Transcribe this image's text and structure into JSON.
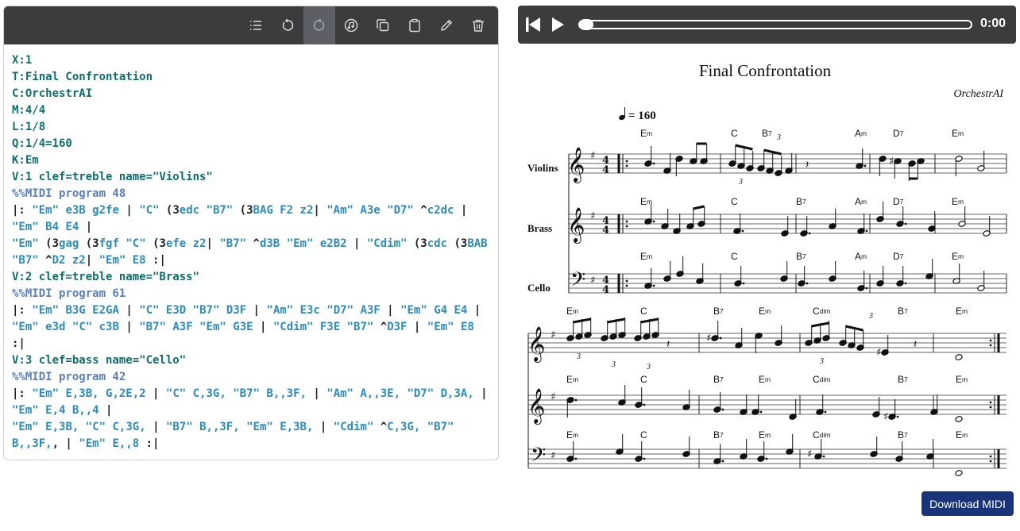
{
  "toolbar": {
    "buttons": [
      {
        "name": "format-button",
        "icon": "list-icon"
      },
      {
        "name": "undo-button",
        "icon": "undo-icon"
      },
      {
        "name": "redo-button",
        "icon": "redo-icon"
      },
      {
        "name": "publish-button",
        "icon": "music-disc-icon"
      },
      {
        "name": "copy-button",
        "icon": "copy-icon"
      },
      {
        "name": "paste-button",
        "icon": "clipboard-icon"
      },
      {
        "name": "edit-button",
        "icon": "pencil-icon"
      },
      {
        "name": "delete-button",
        "icon": "trash-icon"
      }
    ]
  },
  "abc_source": {
    "lines": [
      [
        [
          "hk",
          "X:1"
        ]
      ],
      [
        [
          "hk",
          "T:Final Confrontation"
        ]
      ],
      [
        [
          "hk",
          "C:OrchestrAI"
        ]
      ],
      [
        [
          "hk",
          "M:4/4"
        ]
      ],
      [
        [
          "hk",
          "L:1/8"
        ]
      ],
      [
        [
          "hk",
          "Q:1/4=160"
        ]
      ],
      [
        [
          "hk",
          "K:Em"
        ]
      ],
      [
        [
          "hk",
          "V:1 clef=treble name=\"Violins\""
        ]
      ],
      [
        [
          "dir",
          "%%MIDI program 48"
        ]
      ],
      [
        [
          "pl",
          "|: "
        ],
        [
          "ch",
          "\"Em\""
        ],
        [
          "pl",
          " "
        ],
        [
          "nt",
          "e3B g2fe"
        ],
        [
          "pl",
          " | "
        ],
        [
          "ch",
          "\"C\""
        ],
        [
          "pl",
          " (3"
        ],
        [
          "nt",
          "edc"
        ],
        [
          "pl",
          " "
        ],
        [
          "ch",
          "\"B7\""
        ],
        [
          "pl",
          " (3"
        ],
        [
          "nt",
          "BAG F2 z2"
        ],
        [
          "pl",
          "| "
        ],
        [
          "ch",
          "\"Am\""
        ],
        [
          "pl",
          " "
        ],
        [
          "nt",
          "A3e"
        ],
        [
          "pl",
          " "
        ],
        [
          "ch",
          "\"D7\""
        ],
        [
          "pl",
          " ^"
        ],
        [
          "nt",
          "c2dc"
        ],
        [
          "pl",
          " |"
        ]
      ],
      [
        [
          "ch",
          "\"Em\""
        ],
        [
          "pl",
          " "
        ],
        [
          "nt",
          "B4 E4"
        ],
        [
          "pl",
          " |"
        ]
      ],
      [
        [
          "ch",
          "\"Em\""
        ],
        [
          "pl",
          " (3"
        ],
        [
          "nt",
          "gag"
        ],
        [
          "pl",
          " (3"
        ],
        [
          "nt",
          "fgf"
        ],
        [
          "pl",
          " "
        ],
        [
          "ch",
          "\"C\""
        ],
        [
          "pl",
          " (3"
        ],
        [
          "nt",
          "efe z2"
        ],
        [
          "pl",
          "| "
        ],
        [
          "ch",
          "\"B7\""
        ],
        [
          "pl",
          " ^"
        ],
        [
          "nt",
          "d3B"
        ],
        [
          "pl",
          " "
        ],
        [
          "ch",
          "\"Em\""
        ],
        [
          "pl",
          " "
        ],
        [
          "nt",
          "e2B2"
        ],
        [
          "pl",
          " | "
        ],
        [
          "ch",
          "\"Cdim\""
        ],
        [
          "pl",
          " (3"
        ],
        [
          "nt",
          "cdc"
        ],
        [
          "pl",
          " (3"
        ],
        [
          "nt",
          "BAB"
        ]
      ],
      [
        [
          "ch",
          "\"B7\""
        ],
        [
          "pl",
          " ^"
        ],
        [
          "nt",
          "D2 z2"
        ],
        [
          "pl",
          "| "
        ],
        [
          "ch",
          "\"Em\""
        ],
        [
          "pl",
          " "
        ],
        [
          "nt",
          "E8"
        ],
        [
          "pl",
          " :|"
        ]
      ],
      [
        [
          "hk",
          "V:2 clef=treble name=\"Brass\""
        ]
      ],
      [
        [
          "dir",
          "%%MIDI program 61"
        ]
      ],
      [
        [
          "pl",
          "|: "
        ],
        [
          "ch",
          "\"Em\""
        ],
        [
          "pl",
          " "
        ],
        [
          "nt",
          "B3G E2GA"
        ],
        [
          "pl",
          " | "
        ],
        [
          "ch",
          "\"C\""
        ],
        [
          "pl",
          " "
        ],
        [
          "nt",
          "E3D"
        ],
        [
          "pl",
          " "
        ],
        [
          "ch",
          "\"B7\""
        ],
        [
          "pl",
          " "
        ],
        [
          "nt",
          "D3F"
        ],
        [
          "pl",
          " | "
        ],
        [
          "ch",
          "\"Am\""
        ],
        [
          "pl",
          " "
        ],
        [
          "nt",
          "E3c"
        ],
        [
          "pl",
          " "
        ],
        [
          "ch",
          "\"D7\""
        ],
        [
          "pl",
          " "
        ],
        [
          "nt",
          "A3F"
        ],
        [
          "pl",
          " | "
        ],
        [
          "ch",
          "\"Em\""
        ],
        [
          "pl",
          " "
        ],
        [
          "nt",
          "G4 E4"
        ],
        [
          "pl",
          " |"
        ]
      ],
      [
        [
          "ch",
          "\"Em\""
        ],
        [
          "pl",
          " "
        ],
        [
          "nt",
          "e3d"
        ],
        [
          "pl",
          " "
        ],
        [
          "ch",
          "\"C\""
        ],
        [
          "pl",
          " "
        ],
        [
          "nt",
          "c3B"
        ],
        [
          "pl",
          " | "
        ],
        [
          "ch",
          "\"B7\""
        ],
        [
          "pl",
          " "
        ],
        [
          "nt",
          "A3F"
        ],
        [
          "pl",
          " "
        ],
        [
          "ch",
          "\"Em\""
        ],
        [
          "pl",
          " "
        ],
        [
          "nt",
          "G3E"
        ],
        [
          "pl",
          " | "
        ],
        [
          "ch",
          "\"Cdim\""
        ],
        [
          "pl",
          " "
        ],
        [
          "nt",
          "F3E"
        ],
        [
          "pl",
          " "
        ],
        [
          "ch",
          "\"B7\""
        ],
        [
          "pl",
          " ^"
        ],
        [
          "nt",
          "D3F"
        ],
        [
          "pl",
          " | "
        ],
        [
          "ch",
          "\"Em\""
        ],
        [
          "pl",
          " "
        ],
        [
          "nt",
          "E8"
        ]
      ],
      [
        [
          "pl",
          ":|"
        ]
      ],
      [
        [
          "hk",
          "V:3 clef=bass name=\"Cello\""
        ]
      ],
      [
        [
          "dir",
          "%%MIDI program 42"
        ]
      ],
      [
        [
          "pl",
          "|: "
        ],
        [
          "ch",
          "\"Em\""
        ],
        [
          "pl",
          " "
        ],
        [
          "nt",
          "E,3B, G,2E,2"
        ],
        [
          "pl",
          " | "
        ],
        [
          "ch",
          "\"C\""
        ],
        [
          "pl",
          " "
        ],
        [
          "nt",
          "C,3G,"
        ],
        [
          "pl",
          " "
        ],
        [
          "ch",
          "\"B7\""
        ],
        [
          "pl",
          " "
        ],
        [
          "nt",
          "B,,3F,"
        ],
        [
          "pl",
          " | "
        ],
        [
          "ch",
          "\"Am\""
        ],
        [
          "pl",
          " "
        ],
        [
          "nt",
          "A,,3E,"
        ],
        [
          "pl",
          " "
        ],
        [
          "ch",
          "\"D7\""
        ],
        [
          "pl",
          " "
        ],
        [
          "nt",
          "D,3A,"
        ],
        [
          "pl",
          " |"
        ]
      ],
      [
        [
          "ch",
          "\"Em\""
        ],
        [
          "pl",
          " "
        ],
        [
          "nt",
          "E,4 B,,4"
        ],
        [
          "pl",
          " |"
        ]
      ],
      [
        [
          "ch",
          "\"Em\""
        ],
        [
          "pl",
          " "
        ],
        [
          "nt",
          "E,3B,"
        ],
        [
          "pl",
          " "
        ],
        [
          "ch",
          "\"C\""
        ],
        [
          "pl",
          " "
        ],
        [
          "nt",
          "C,3G,"
        ],
        [
          "pl",
          " | "
        ],
        [
          "ch",
          "\"B7\""
        ],
        [
          "pl",
          " "
        ],
        [
          "nt",
          "B,,3F,"
        ],
        [
          "pl",
          " "
        ],
        [
          "ch",
          "\"Em\""
        ],
        [
          "pl",
          " "
        ],
        [
          "nt",
          "E,3B,"
        ],
        [
          "pl",
          " | "
        ],
        [
          "ch",
          "\"Cdim\""
        ],
        [
          "pl",
          " ^"
        ],
        [
          "nt",
          "C,3G,"
        ],
        [
          "pl",
          " "
        ],
        [
          "ch",
          "\"B7\""
        ]
      ],
      [
        [
          "nt",
          "B,,3F,"
        ],
        [
          "pl",
          ", | "
        ],
        [
          "ch",
          "\"Em\""
        ],
        [
          "pl",
          " "
        ],
        [
          "nt",
          "E,,8"
        ],
        [
          "pl",
          " :|"
        ]
      ]
    ]
  },
  "player": {
    "time": "0:00",
    "progress": 0,
    "skip_icon": "skip-back-icon",
    "play_icon": "play-icon"
  },
  "score": {
    "title": "Final Confrontation",
    "composer": "OrchestrAI",
    "tempo_text": "= 160",
    "voices": [
      "Violins",
      "Brass",
      "Cello"
    ],
    "system1_chords": {
      "violins": [
        "Em",
        "C",
        "B7",
        "Am",
        "D7",
        "Em"
      ],
      "brass": [
        "Em",
        "C",
        "B7",
        "Am",
        "D7",
        "Em"
      ],
      "cello": [
        "Em",
        "C",
        "B7",
        "Am",
        "D7",
        "Em"
      ]
    },
    "system2_chords": [
      "Em",
      "C",
      "B7",
      "Em",
      "Cdim",
      "B7",
      "Em"
    ],
    "triplet_mark": "3"
  },
  "download_label": "Download MIDI",
  "colors": {
    "toolbar_bg": "#3c3c3c",
    "toolbar_active": "#5c6066",
    "header_text": "#0d6e6e",
    "directive_text": "#5a7fc0",
    "token_text": "#2b8bbf",
    "button_bg": "#1a347a"
  }
}
